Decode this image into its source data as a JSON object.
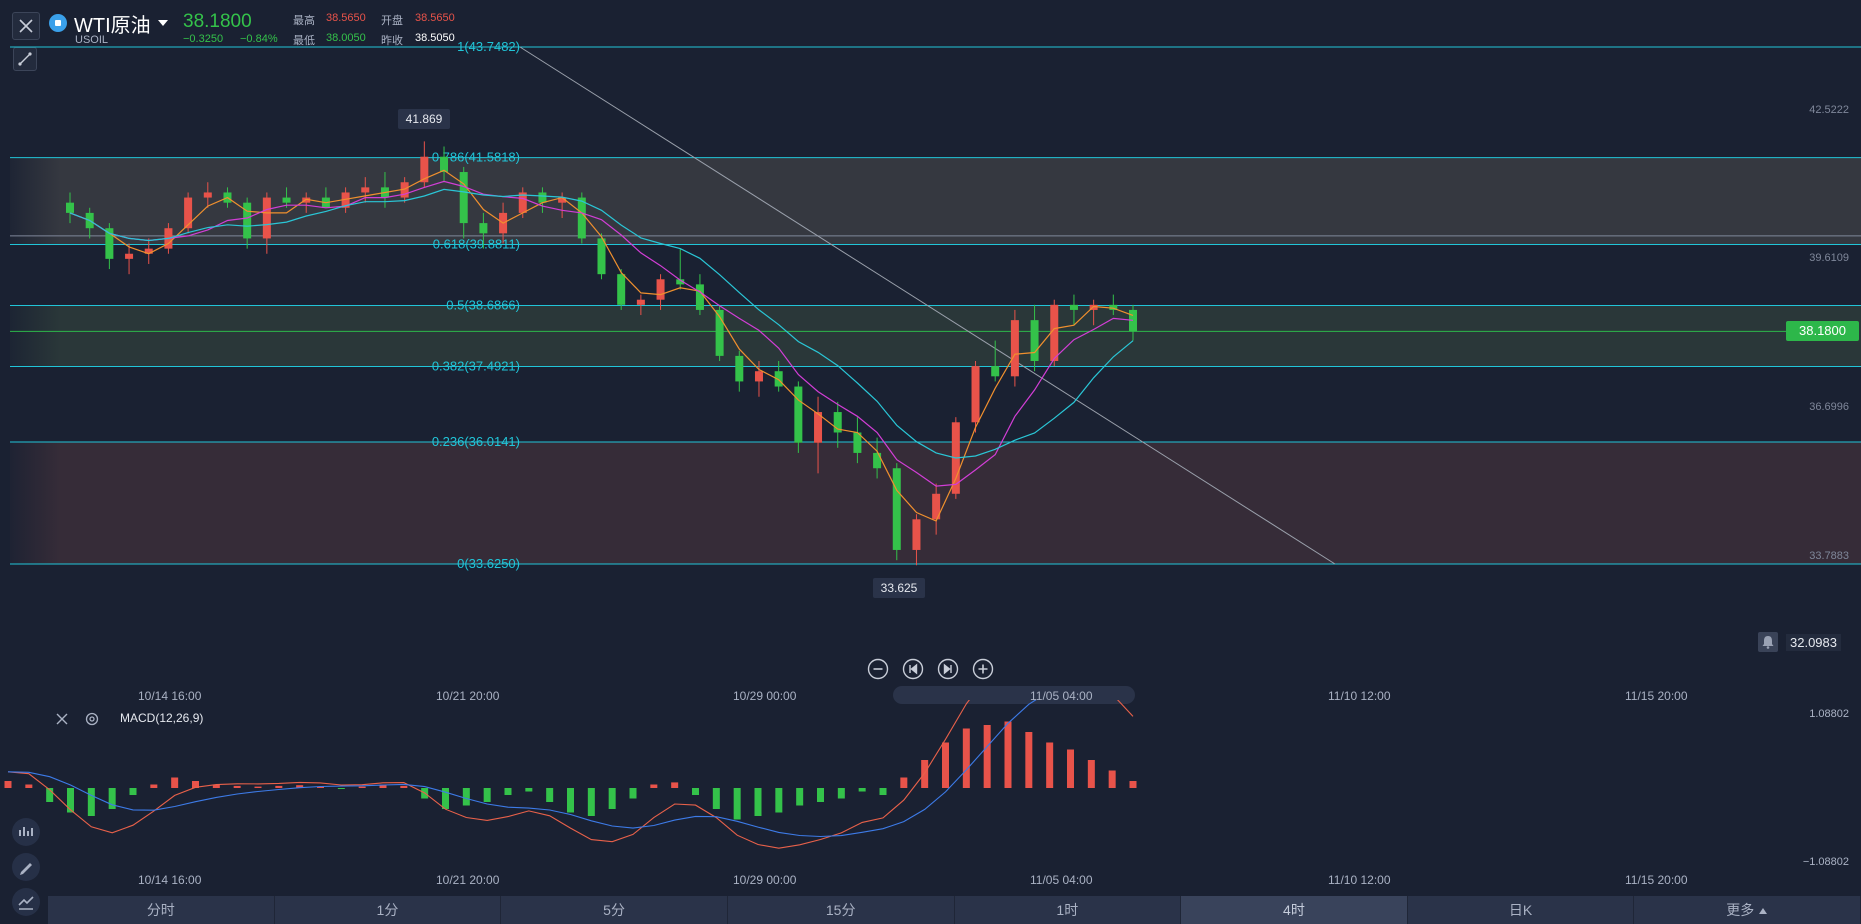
{
  "header": {
    "symbol_name": "WTI原油",
    "symbol_code": "USOIL",
    "price": "38.1800",
    "change": "−0.3250",
    "change_pct": "−0.84%",
    "high_label": "最高",
    "high": "38.5650",
    "open_label": "开盘",
    "open": "38.5650",
    "low_label": "最低",
    "low": "38.0050",
    "prev_close_label": "昨收",
    "prev_close": "38.5050",
    "dropdown_icon": "caret-down-icon",
    "colors": {
      "up": "#e8534a",
      "down": "#34c24a",
      "accent": "#21c5d8"
    }
  },
  "tools": {
    "close_icon": "close-icon",
    "draw_icon": "draw-line-icon"
  },
  "price_axis": {
    "labels": [
      "42.5222",
      "39.6109",
      "36.6996",
      "33.7883",
      "32.0983"
    ],
    "current": "38.1800"
  },
  "annotations": {
    "high_tag": "41.869",
    "low_tag": "33.625"
  },
  "fib_levels": [
    {
      "label": "1(43.7482)",
      "value": 43.7482
    },
    {
      "label": "0.786(41.5818)",
      "value": 41.5818
    },
    {
      "label": "0.618(39.8811)",
      "value": 39.8811
    },
    {
      "label": "0.5(38.6866)",
      "value": 38.6866
    },
    {
      "label": "0.382(37.4921)",
      "value": 37.4921
    },
    {
      "label": "0.236(36.0141)",
      "value": 36.0141
    },
    {
      "label": "0(33.6250)",
      "value": 33.625
    }
  ],
  "nav_controls": [
    "zoom-out-icon",
    "skip-start-icon",
    "skip-end-icon",
    "zoom-in-icon"
  ],
  "x_axis_main": [
    "10/14 16:00",
    "10/21 20:00",
    "10/29 00:00",
    "11/05 04:00",
    "11/10 12:00",
    "11/15 20:00"
  ],
  "macd_panel": {
    "label": "MACD(12,26,9)",
    "axis_top": "1.08802",
    "axis_bottom": "−1.08802",
    "close_icon": "close-icon",
    "settings_icon": "settings-icon"
  },
  "x_axis_macd": [
    "10/14 16:00",
    "10/21 20:00",
    "10/29 00:00",
    "11/05 04:00",
    "11/10 12:00",
    "11/15 20:00"
  ],
  "timeframes": [
    "分时",
    "1分",
    "5分",
    "15分",
    "1时",
    "4时",
    "日K",
    "更多"
  ],
  "active_timeframe": "4时",
  "left_tools": [
    "indicator-icon",
    "pen-icon",
    "chart-line-icon"
  ],
  "chart_data": {
    "type": "candlestick",
    "symbol": "USOIL",
    "ylim": [
      32.0983,
      43.7482
    ],
    "candles_ohlc": [
      [
        40.7,
        40.9,
        40.3,
        40.5
      ],
      [
        40.5,
        40.6,
        40.0,
        40.2
      ],
      [
        40.2,
        40.3,
        39.4,
        39.6
      ],
      [
        39.6,
        39.9,
        39.3,
        39.7
      ],
      [
        39.7,
        40.0,
        39.5,
        39.8
      ],
      [
        39.8,
        40.3,
        39.7,
        40.2
      ],
      [
        40.2,
        40.9,
        40.1,
        40.8
      ],
      [
        40.8,
        41.1,
        40.6,
        40.9
      ],
      [
        40.9,
        41.0,
        40.6,
        40.7
      ],
      [
        40.7,
        40.8,
        39.8,
        40.0
      ],
      [
        40.0,
        40.9,
        39.7,
        40.8
      ],
      [
        40.8,
        41.0,
        40.6,
        40.7
      ],
      [
        40.7,
        40.9,
        40.5,
        40.8
      ],
      [
        40.8,
        41.0,
        40.6,
        40.6
      ],
      [
        40.6,
        41.0,
        40.5,
        40.9
      ],
      [
        40.9,
        41.2,
        40.7,
        41.0
      ],
      [
        41.0,
        41.3,
        40.6,
        40.8
      ],
      [
        40.8,
        41.2,
        40.7,
        41.1
      ],
      [
        41.1,
        41.9,
        41.0,
        41.6
      ],
      [
        41.6,
        41.8,
        41.1,
        41.3
      ],
      [
        41.3,
        41.4,
        40.0,
        40.3
      ],
      [
        40.3,
        40.5,
        39.8,
        40.1
      ],
      [
        40.1,
        40.7,
        39.9,
        40.5
      ],
      [
        40.5,
        41.0,
        40.4,
        40.9
      ],
      [
        40.9,
        41.0,
        40.5,
        40.7
      ],
      [
        40.7,
        40.9,
        40.4,
        40.8
      ],
      [
        40.8,
        40.9,
        39.9,
        40.0
      ],
      [
        40.0,
        40.1,
        39.2,
        39.3
      ],
      [
        39.3,
        39.4,
        38.6,
        38.7
      ],
      [
        38.7,
        38.9,
        38.5,
        38.8
      ],
      [
        38.8,
        39.3,
        38.6,
        39.2
      ],
      [
        39.2,
        39.8,
        39.0,
        39.1
      ],
      [
        39.1,
        39.3,
        38.5,
        38.6
      ],
      [
        38.6,
        38.7,
        37.6,
        37.7
      ],
      [
        37.7,
        37.8,
        37.0,
        37.2
      ],
      [
        37.2,
        37.6,
        36.9,
        37.4
      ],
      [
        37.4,
        37.6,
        37.0,
        37.1
      ],
      [
        37.1,
        37.2,
        35.8,
        36.0
      ],
      [
        36.0,
        36.9,
        35.4,
        36.6
      ],
      [
        36.6,
        36.8,
        35.9,
        36.2
      ],
      [
        36.2,
        36.5,
        35.6,
        35.8
      ],
      [
        35.8,
        36.1,
        35.3,
        35.5
      ],
      [
        35.5,
        35.6,
        33.7,
        33.9
      ],
      [
        33.9,
        34.6,
        33.6,
        34.5
      ],
      [
        34.5,
        35.2,
        34.2,
        35.0
      ],
      [
        35.0,
        36.5,
        34.9,
        36.4
      ],
      [
        36.4,
        37.6,
        36.2,
        37.5
      ],
      [
        37.5,
        38.0,
        37.2,
        37.3
      ],
      [
        37.3,
        38.6,
        37.1,
        38.4
      ],
      [
        38.4,
        38.7,
        37.4,
        37.6
      ],
      [
        37.6,
        38.8,
        37.5,
        38.7
      ],
      [
        38.7,
        38.9,
        38.3,
        38.6
      ],
      [
        38.6,
        38.8,
        38.3,
        38.7
      ],
      [
        38.7,
        38.9,
        38.5,
        38.6
      ],
      [
        38.6,
        38.7,
        38.0,
        38.18
      ]
    ],
    "ma_series": [
      "orange",
      "magenta",
      "cyan"
    ],
    "macd": {
      "histogram": [
        0.1,
        0.05,
        -0.2,
        -0.35,
        -0.4,
        -0.3,
        -0.1,
        0.05,
        0.15,
        0.1,
        0.05,
        0.03,
        0.02,
        0.03,
        0.04,
        0.02,
        -0.01,
        0.02,
        0.05,
        0.03,
        -0.15,
        -0.3,
        -0.25,
        -0.2,
        -0.1,
        -0.05,
        -0.2,
        -0.35,
        -0.4,
        -0.3,
        -0.15,
        0.05,
        0.08,
        -0.1,
        -0.3,
        -0.45,
        -0.4,
        -0.35,
        -0.25,
        -0.2,
        -0.15,
        -0.05,
        -0.1,
        0.15,
        0.4,
        0.65,
        0.85,
        0.9,
        0.95,
        0.8,
        0.65,
        0.55,
        0.4,
        0.25,
        0.1
      ],
      "dif_color": "#e8614a",
      "dea_color": "#3d7be8"
    }
  }
}
